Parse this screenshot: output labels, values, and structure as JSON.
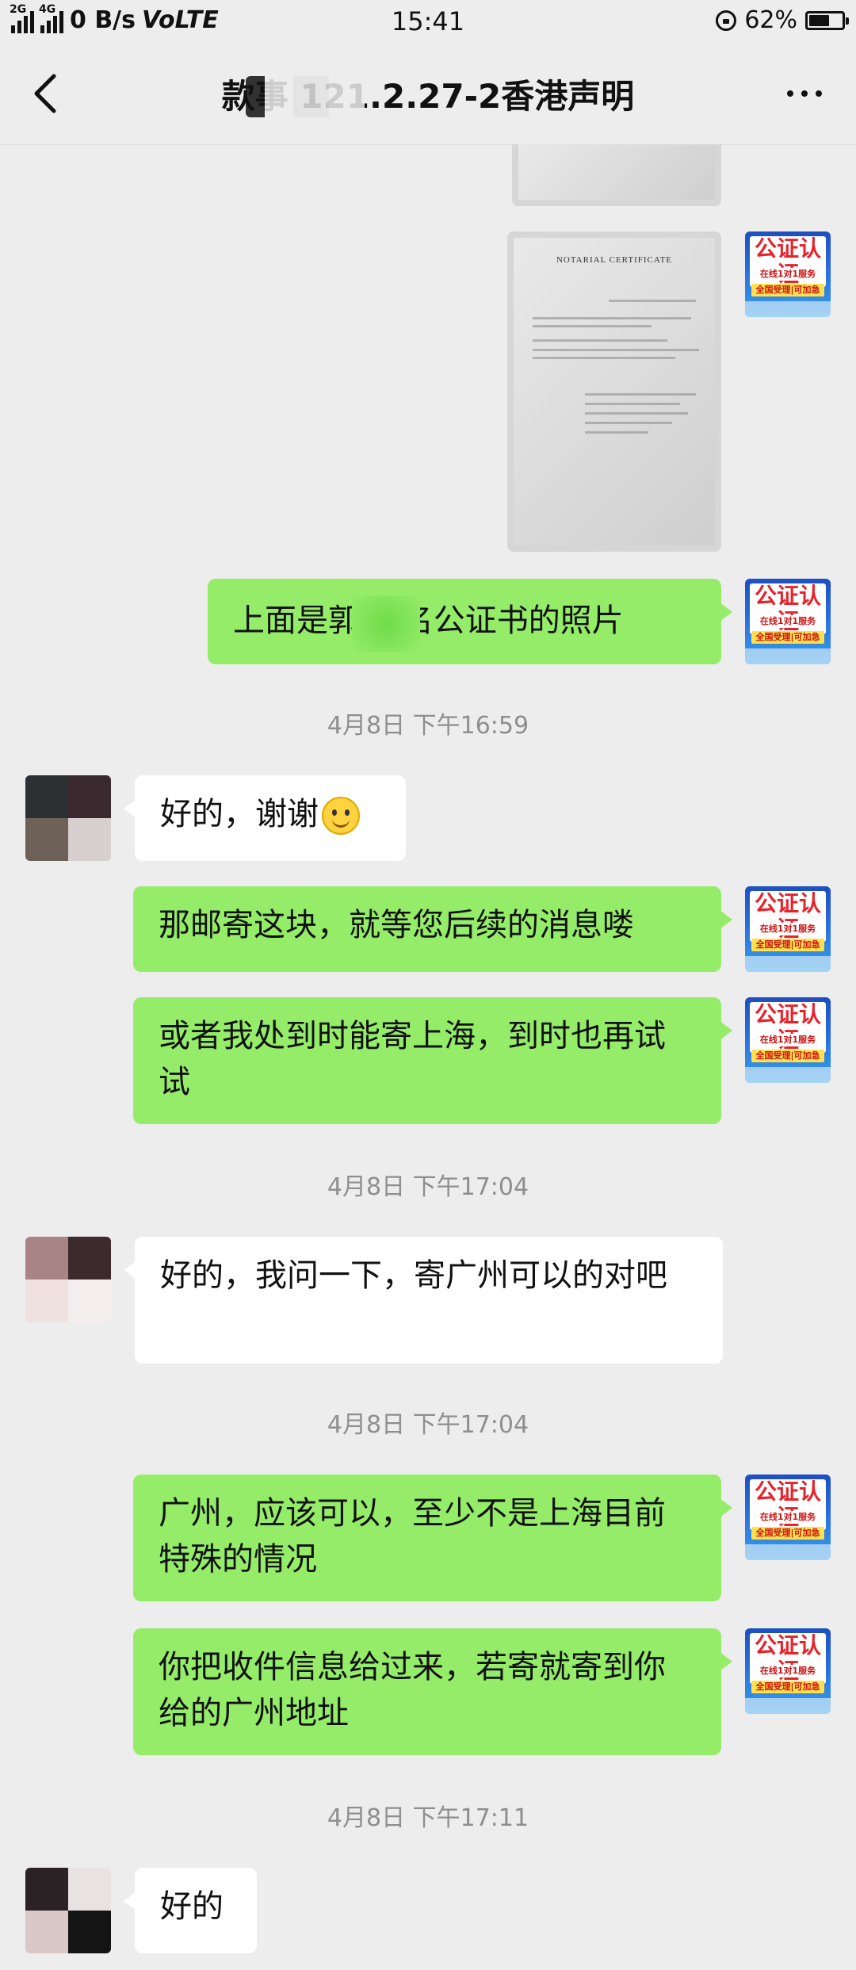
{
  "status_bar": {
    "network_a": "2G",
    "network_b": "4G",
    "speed": "0 B/s",
    "volte": "VoLTE",
    "time": "15:41",
    "battery": "62%",
    "battery_level": 0.62
  },
  "nav": {
    "title": "款事 121.2.27-2香港声明",
    "back_icon": "chevron-left-icon",
    "more_icon": "more-dots-icon"
  },
  "certificate": {
    "title": "NOTARIAL CERTIFICATE"
  },
  "avatar_badge": {
    "top": "公证认证",
    "line1": "在线1对1服务",
    "line2": "全国受理|可加急"
  },
  "messages": [
    {
      "side": "right",
      "text": "上面是郭  签名公证书的照片"
    },
    {
      "side": "left",
      "text": "好的，谢谢"
    },
    {
      "side": "right",
      "text": "那邮寄这块，就等您后续的消息喽"
    },
    {
      "side": "right",
      "text": "或者我处到时能寄上海，到时也再试试"
    },
    {
      "side": "left",
      "text": "好的，我问一下，寄广州可以的对吧"
    },
    {
      "side": "right",
      "text": "广州，应该可以，至少不是上海目前特殊的情况"
    },
    {
      "side": "right",
      "text": "你把收件信息给过来，若寄就寄到你给的广州地址"
    },
    {
      "side": "left",
      "text": "好的"
    }
  ],
  "timestamps": [
    "4月8日 下午16:59",
    "4月8日 下午17:04",
    "4月8日 下午17:04",
    "4月8日 下午17:11"
  ]
}
